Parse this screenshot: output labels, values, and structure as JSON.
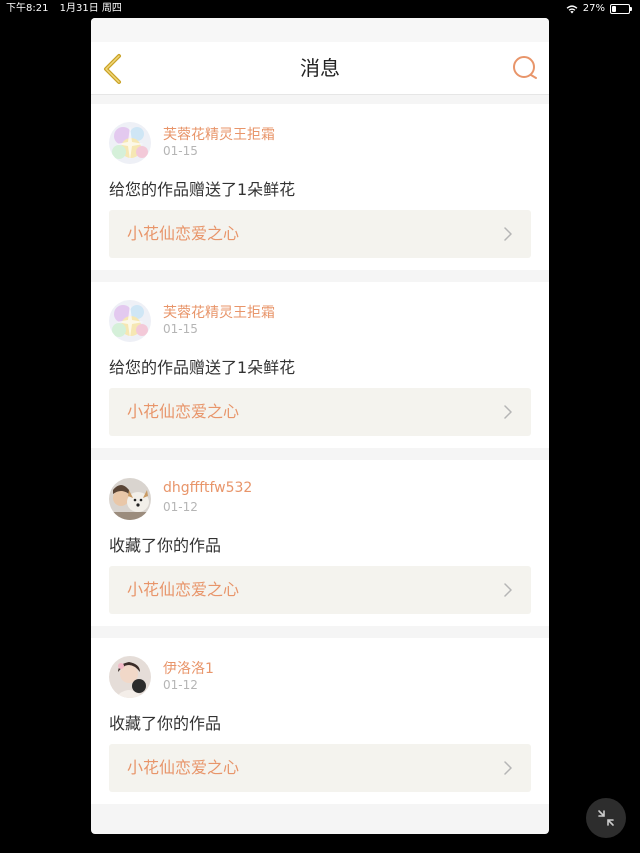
{
  "status_bar": {
    "time": "下午8:21",
    "date": "1月31日 周四",
    "battery": "27%",
    "battery_level": 0.27
  },
  "header": {
    "title": "消息",
    "back_icon": "chevron-left-icon",
    "search_icon": "search-icon"
  },
  "colors": {
    "accent": "#e8956a",
    "back_arrow": "#c9a227"
  },
  "messages": [
    {
      "user": "芙蓉花精灵王拒霜",
      "date": "01-15",
      "text": "给您的作品赠送了1朵鲜花",
      "work": "小花仙恋爱之心",
      "avatar": "flower-fairy-avatar"
    },
    {
      "user": "芙蓉花精灵王拒霜",
      "date": "01-15",
      "text": "给您的作品赠送了1朵鲜花",
      "work": "小花仙恋爱之心",
      "avatar": "flower-fairy-avatar"
    },
    {
      "user": "dhgffftfw532",
      "date": "01-12",
      "text": "收藏了你的作品",
      "work": "小花仙恋爱之心",
      "avatar": "dog-photo-avatar"
    },
    {
      "user": "伊洛洛1",
      "date": "01-12",
      "text": "收藏了你的作品",
      "work": "小花仙恋爱之心",
      "avatar": "girl-photo-avatar"
    }
  ],
  "floating_button_icon": "collapse-arrows-icon"
}
